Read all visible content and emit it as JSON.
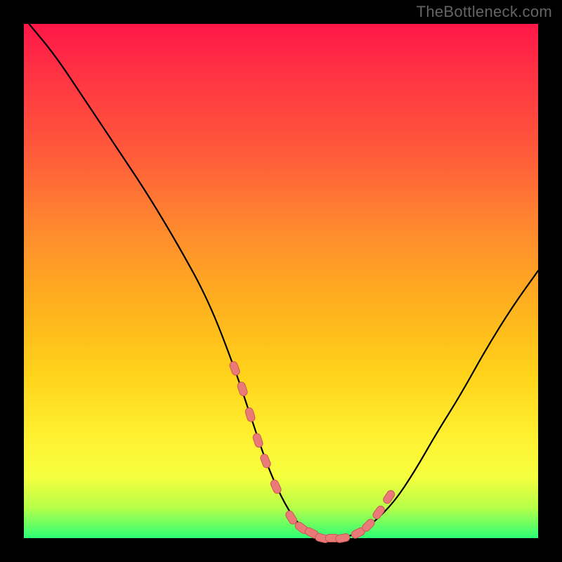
{
  "watermark": "TheBottleneck.com",
  "colors": {
    "background": "#000000",
    "gradient_top": "#ff1748",
    "gradient_mid": "#ffd21a",
    "gradient_bottom": "#2cff76",
    "curve": "#000000",
    "dot_fill": "#e97a78",
    "dot_stroke": "#c95a57"
  },
  "chart_data": {
    "type": "line",
    "title": "",
    "xlabel": "",
    "ylabel": "",
    "xlim": [
      0,
      100
    ],
    "ylim": [
      0,
      100
    ],
    "grid": false,
    "legend": false,
    "series": [
      {
        "name": "bottleneck-curve",
        "x": [
          1,
          6,
          12,
          18,
          24,
          30,
          36,
          41,
          44,
          47,
          50,
          53,
          56,
          59,
          62,
          65,
          68,
          72,
          76,
          80,
          85,
          90,
          95,
          100
        ],
        "y": [
          100,
          94,
          85,
          76,
          67,
          57,
          46,
          33,
          24,
          15,
          8,
          3,
          1,
          0,
          0,
          1,
          3,
          7,
          13,
          20,
          28,
          37,
          45,
          52
        ]
      }
    ],
    "highlight_points": {
      "name": "marked-segments",
      "x": [
        41,
        42.5,
        44,
        45.5,
        47,
        49,
        52,
        54,
        56,
        58,
        60,
        62,
        65,
        67,
        69,
        71
      ],
      "y": [
        33,
        29,
        24,
        19,
        15,
        10,
        4,
        2,
        1,
        0,
        0,
        0,
        1,
        2.5,
        5,
        8
      ]
    }
  }
}
